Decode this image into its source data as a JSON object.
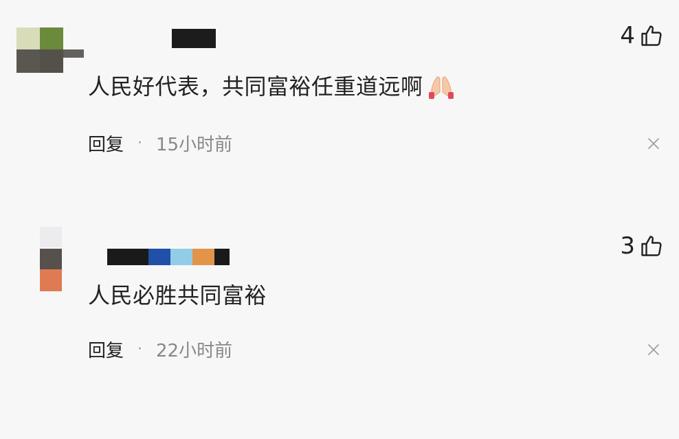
{
  "comments": [
    {
      "text": "人民好代表，共同富裕任重道远啊",
      "emoji": "folded-hands",
      "likes": "4",
      "reply_label": "回复",
      "separator": "·",
      "time": "15小时前"
    },
    {
      "text": "人民必胜共同富裕",
      "likes": "3",
      "reply_label": "回复",
      "separator": "·",
      "time": "22小时前"
    }
  ],
  "colors": {
    "background": "#f7f7f8",
    "text": "#222222",
    "muted": "#888888"
  },
  "icons": {
    "like": "thumbs-up-icon",
    "close": "close-icon",
    "emoji": "folded-hands-icon"
  }
}
